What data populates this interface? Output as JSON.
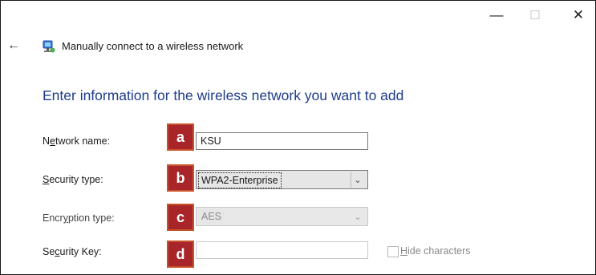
{
  "window": {
    "title": "Manually connect to a wireless network",
    "minimize_glyph": "—",
    "maximize_glyph": "☐",
    "close_glyph": "✕",
    "back_glyph": "←"
  },
  "heading": "Enter information for the wireless network you want to add",
  "fields": {
    "network_name": {
      "label": "Network name:",
      "value": "KSU",
      "marker": "a"
    },
    "security_type": {
      "label": "Security type:",
      "value": "WPA2-Enterprise",
      "marker": "b"
    },
    "encryption_type": {
      "label": "Encryption type:",
      "value": "AES",
      "marker": "c"
    },
    "security_key": {
      "label": "Security Key:",
      "value": "",
      "marker": "d"
    }
  },
  "hide_characters": {
    "label": "Hide characters",
    "checked": false
  },
  "colors": {
    "heading": "#1e3c8c",
    "marker_fill": "#a8262a",
    "marker_border": "#c8532a"
  }
}
